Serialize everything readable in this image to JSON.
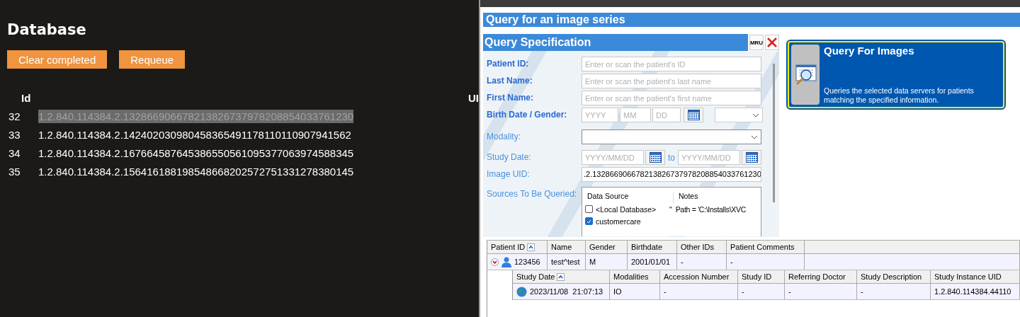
{
  "database": {
    "title": "Database",
    "buttons": [
      "Clear completed",
      "Requeue"
    ],
    "columns": [
      "Id",
      "UI"
    ],
    "rows": [
      {
        "id": "32",
        "uid": "1.2.840.114384.2.132866906678213826737978208854033761230",
        "selected": true
      },
      {
        "id": "33",
        "uid": "1.2.840.114384.2.142402030980458365491178110110907941562",
        "selected": false
      },
      {
        "id": "34",
        "uid": "1.2.840.114384.2.167664587645386550561095377063974588345",
        "selected": false
      },
      {
        "id": "35",
        "uid": "1.2.840.114384.2.156416188198548668202572751331278380145",
        "selected": false
      }
    ]
  },
  "query": {
    "title": "Query for an image series",
    "spec_title": "Query Specification",
    "mru": "MRU",
    "fields": [
      {
        "kind": "text",
        "label": "Patient ID:",
        "bold": true,
        "placeholder": "Enter or scan the patient's ID"
      },
      {
        "kind": "text",
        "label": "Last Name:",
        "bold": true,
        "placeholder": "Enter or scan the patient's last name"
      },
      {
        "kind": "text",
        "label": "First Name:",
        "bold": true,
        "placeholder": "Enter or scan the patient's first name"
      },
      {
        "kind": "birth",
        "label": "Birth Date / Gender:",
        "bold": true,
        "placeholders": [
          "YYYY",
          "MM",
          "DD"
        ]
      },
      {
        "kind": "combo",
        "label": "Modality:",
        "bold": false
      },
      {
        "kind": "range",
        "label": "Study Date:",
        "bold": false,
        "from_placeholder": "YYYY/MM/DD",
        "to_label": "to",
        "to_placeholder": "YYYY/MM/DD"
      },
      {
        "kind": "value",
        "label": "Image UID:",
        "bold": false,
        "value": ".2.132866906678213826737978208854033761230"
      },
      {
        "kind": "sources",
        "label": "Sources To Be Queried:",
        "bold": false,
        "columns": [
          "Data Source",
          "Notes"
        ],
        "rows": [
          {
            "name": "<Local Database>",
            "checked": false,
            "notes": "\"  Path = 'C:\\Installs\\XVC"
          },
          {
            "name": "customercare",
            "checked": true,
            "notes": ""
          }
        ]
      }
    ],
    "action": {
      "title": "Query For Images",
      "description": "Queries the selected data servers for patients matching the specified information."
    }
  },
  "patients": {
    "columns": [
      {
        "label": "Patient ID",
        "sorted": true
      },
      {
        "label": "Name",
        "sorted": false
      },
      {
        "label": "Gender",
        "sorted": false
      },
      {
        "label": "Birthdate",
        "sorted": false
      },
      {
        "label": "Other IDs",
        "sorted": false
      },
      {
        "label": "Patient Comments",
        "sorted": false
      }
    ],
    "rows": [
      {
        "cells": [
          "123456",
          "test^test",
          "M",
          "2001/01/01",
          "-",
          "-"
        ],
        "expanded": true,
        "studies": {
          "columns": [
            {
              "label": "Study Date",
              "sorted": true
            },
            {
              "label": "Modalities",
              "sorted": false
            },
            {
              "label": "Accession Number",
              "sorted": false
            },
            {
              "label": "Study ID",
              "sorted": false
            },
            {
              "label": "Referring Doctor",
              "sorted": false
            },
            {
              "label": "Study Description",
              "sorted": false
            },
            {
              "label": "Study Instance UID",
              "sorted": false
            }
          ],
          "rows": [
            {
              "cells": [
                "2023/11/08  21:07:13",
                "IO",
                "-",
                "-",
                "-",
                "-",
                "1.2.840.114384.44110"
              ]
            }
          ]
        }
      }
    ]
  }
}
